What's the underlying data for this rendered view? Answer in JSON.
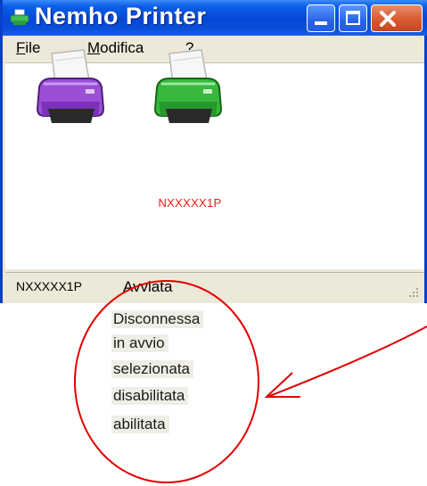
{
  "window": {
    "title": "Nemho Printer",
    "icon": "printer-icon",
    "controls": [
      "minimize-icon",
      "maximize-icon",
      "close-icon"
    ]
  },
  "menu": {
    "file": {
      "mnemonic": "F",
      "rest": "ile"
    },
    "edit": {
      "mnemonic": "M",
      "rest": "odifica"
    },
    "help": {
      "label": "?"
    }
  },
  "printers": [
    {
      "icon": "printer-icon",
      "color": "#8a3fc4",
      "label": ""
    },
    {
      "icon": "printer-icon",
      "color": "#2ea82e",
      "label": "NXXXXX1P",
      "label_color": "#e81c10"
    }
  ],
  "status": {
    "printer": "NXXXXX1P",
    "state": "Avviata"
  },
  "annotation": {
    "states": [
      "Disconnessa",
      "in avvio",
      "selezionata",
      "disabilitata",
      "abilitata"
    ],
    "color": "#e00000"
  }
}
